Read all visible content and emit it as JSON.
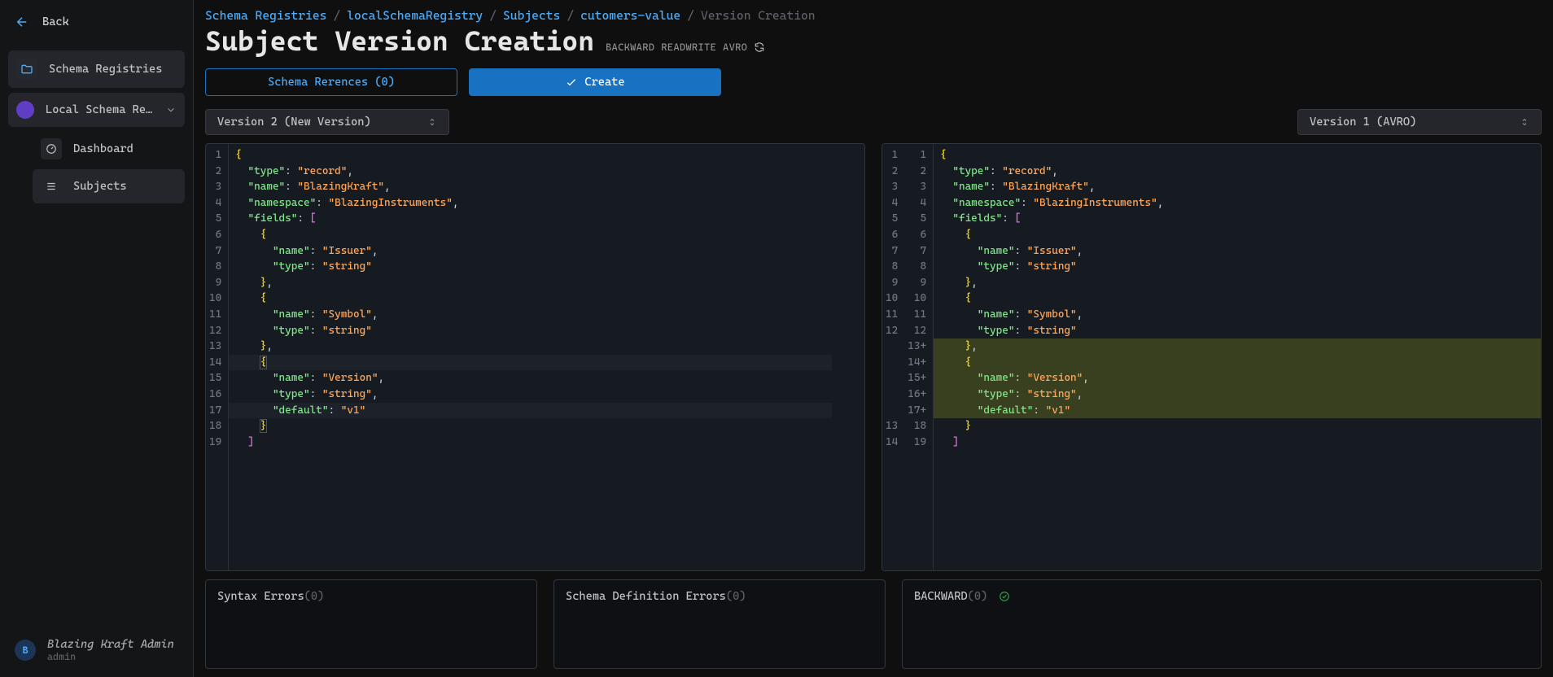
{
  "sidebar": {
    "back": "Back",
    "schemaRegistries": "Schema Registries",
    "localRegistry": "Local Schema Regi…",
    "dashboard": "Dashboard",
    "subjects": "Subjects",
    "userName": "Blazing Kraft Admin",
    "userSub": "admin",
    "userInitial": "B"
  },
  "breadcrumb": {
    "a": "Schema Registries",
    "b": "localSchemaRegistry",
    "c": "Subjects",
    "d": "cutomers-value",
    "e": "Version Creation"
  },
  "header": {
    "title": "Subject Version Creation",
    "tag1": "BACKWARD",
    "tag2": "READWRITE",
    "tag3": "AVRO"
  },
  "actions": {
    "refsBtn": "Schema Rerences (0)",
    "createBtn": "Create"
  },
  "selects": {
    "left": "Version 2 (New Version)",
    "right": "Version 1 (AVRO)"
  },
  "left_editor": {
    "gutter": [
      "1",
      "2",
      "3",
      "4",
      "5",
      "6",
      "7",
      "8",
      "9",
      "10",
      "11",
      "12",
      "13",
      "14",
      "15",
      "16",
      "17",
      "18",
      "19"
    ],
    "lines": [
      {
        "tokens": [
          {
            "t": "{",
            "c": "tok-brc"
          }
        ]
      },
      {
        "tokens": [
          {
            "t": "  ",
            "c": "tok-pun"
          },
          {
            "t": "\"type\"",
            "c": "tok-key"
          },
          {
            "t": ": ",
            "c": "tok-pun"
          },
          {
            "t": "\"record\"",
            "c": "tok-str"
          },
          {
            "t": ",",
            "c": "tok-pun"
          }
        ]
      },
      {
        "tokens": [
          {
            "t": "  ",
            "c": "tok-pun"
          },
          {
            "t": "\"name\"",
            "c": "tok-key"
          },
          {
            "t": ": ",
            "c": "tok-pun"
          },
          {
            "t": "\"BlazingKraft\"",
            "c": "tok-str"
          },
          {
            "t": ",",
            "c": "tok-pun"
          }
        ]
      },
      {
        "tokens": [
          {
            "t": "  ",
            "c": "tok-pun"
          },
          {
            "t": "\"namespace\"",
            "c": "tok-key"
          },
          {
            "t": ": ",
            "c": "tok-pun"
          },
          {
            "t": "\"BlazingInstruments\"",
            "c": "tok-str"
          },
          {
            "t": ",",
            "c": "tok-pun"
          }
        ]
      },
      {
        "tokens": [
          {
            "t": "  ",
            "c": "tok-pun"
          },
          {
            "t": "\"fields\"",
            "c": "tok-key"
          },
          {
            "t": ": ",
            "c": "tok-pun"
          },
          {
            "t": "[",
            "c": "tok-sqb"
          }
        ]
      },
      {
        "tokens": [
          {
            "t": "    ",
            "c": "tok-pun"
          },
          {
            "t": "{",
            "c": "tok-brc"
          }
        ]
      },
      {
        "tokens": [
          {
            "t": "      ",
            "c": "tok-pun"
          },
          {
            "t": "\"name\"",
            "c": "tok-key"
          },
          {
            "t": ": ",
            "c": "tok-pun"
          },
          {
            "t": "\"Issuer\"",
            "c": "tok-str"
          },
          {
            "t": ",",
            "c": "tok-pun"
          }
        ]
      },
      {
        "tokens": [
          {
            "t": "      ",
            "c": "tok-pun"
          },
          {
            "t": "\"type\"",
            "c": "tok-key"
          },
          {
            "t": ": ",
            "c": "tok-pun"
          },
          {
            "t": "\"string\"",
            "c": "tok-str"
          }
        ]
      },
      {
        "tokens": [
          {
            "t": "    ",
            "c": "tok-pun"
          },
          {
            "t": "}",
            "c": "tok-brc"
          },
          {
            "t": ",",
            "c": "tok-pun"
          }
        ]
      },
      {
        "tokens": [
          {
            "t": "    ",
            "c": "tok-pun"
          },
          {
            "t": "{",
            "c": "tok-brc"
          }
        ]
      },
      {
        "tokens": [
          {
            "t": "      ",
            "c": "tok-pun"
          },
          {
            "t": "\"name\"",
            "c": "tok-key"
          },
          {
            "t": ": ",
            "c": "tok-pun"
          },
          {
            "t": "\"Symbol\"",
            "c": "tok-str"
          },
          {
            "t": ",",
            "c": "tok-pun"
          }
        ]
      },
      {
        "tokens": [
          {
            "t": "      ",
            "c": "tok-pun"
          },
          {
            "t": "\"type\"",
            "c": "tok-key"
          },
          {
            "t": ": ",
            "c": "tok-pun"
          },
          {
            "t": "\"string\"",
            "c": "tok-str"
          }
        ]
      },
      {
        "tokens": [
          {
            "t": "    ",
            "c": "tok-pun"
          },
          {
            "t": "}",
            "c": "tok-brc"
          },
          {
            "t": ",",
            "c": "tok-pun"
          }
        ]
      },
      {
        "hl": "cursor",
        "tokens": [
          {
            "t": "    ",
            "c": "tok-pun"
          },
          {
            "t": "{",
            "c": "tok-brc hl-bracket"
          }
        ]
      },
      {
        "tokens": [
          {
            "t": "      ",
            "c": "tok-pun"
          },
          {
            "t": "\"name\"",
            "c": "tok-key"
          },
          {
            "t": ": ",
            "c": "tok-pun"
          },
          {
            "t": "\"Version\"",
            "c": "tok-str"
          },
          {
            "t": ",",
            "c": "tok-pun"
          }
        ]
      },
      {
        "tokens": [
          {
            "t": "      ",
            "c": "tok-pun"
          },
          {
            "t": "\"type\"",
            "c": "tok-key"
          },
          {
            "t": ": ",
            "c": "tok-pun"
          },
          {
            "t": "\"string\"",
            "c": "tok-str"
          },
          {
            "t": ",",
            "c": "tok-pun"
          }
        ]
      },
      {
        "hl": "cursor",
        "tokens": [
          {
            "t": "      ",
            "c": "tok-pun"
          },
          {
            "t": "\"default\"",
            "c": "tok-key"
          },
          {
            "t": ": ",
            "c": "tok-pun"
          },
          {
            "t": "\"v1\"",
            "c": "tok-str"
          }
        ]
      },
      {
        "tokens": [
          {
            "t": "    ",
            "c": "tok-pun"
          },
          {
            "t": "}",
            "c": "tok-brc hl-bracket"
          }
        ]
      },
      {
        "tokens": [
          {
            "t": "  ",
            "c": "tok-pun"
          },
          {
            "t": "]",
            "c": "tok-sqb"
          }
        ]
      }
    ]
  },
  "right_editor": {
    "gutterA": [
      "1",
      "2",
      "3",
      "4",
      "5",
      "6",
      "7",
      "8",
      "9",
      "10",
      "11",
      "12",
      "",
      "",
      "",
      "",
      "",
      "13",
      "14"
    ],
    "gutterB": [
      "1",
      "2",
      "3",
      "4",
      "5",
      "6",
      "7",
      "8",
      "9",
      "10",
      "11",
      "12",
      "13+",
      "14+",
      "15+",
      "16+",
      "17+",
      "18",
      "19"
    ],
    "lines": [
      {
        "tokens": [
          {
            "t": "{",
            "c": "tok-brc"
          }
        ]
      },
      {
        "tokens": [
          {
            "t": "  ",
            "c": "tok-pun"
          },
          {
            "t": "\"type\"",
            "c": "tok-key"
          },
          {
            "t": ": ",
            "c": "tok-pun"
          },
          {
            "t": "\"record\"",
            "c": "tok-str"
          },
          {
            "t": ",",
            "c": "tok-pun"
          }
        ]
      },
      {
        "tokens": [
          {
            "t": "  ",
            "c": "tok-pun"
          },
          {
            "t": "\"name\"",
            "c": "tok-key"
          },
          {
            "t": ": ",
            "c": "tok-pun"
          },
          {
            "t": "\"BlazingKraft\"",
            "c": "tok-str"
          },
          {
            "t": ",",
            "c": "tok-pun"
          }
        ]
      },
      {
        "tokens": [
          {
            "t": "  ",
            "c": "tok-pun"
          },
          {
            "t": "\"namespace\"",
            "c": "tok-key"
          },
          {
            "t": ": ",
            "c": "tok-pun"
          },
          {
            "t": "\"BlazingInstruments\"",
            "c": "tok-str"
          },
          {
            "t": ",",
            "c": "tok-pun"
          }
        ]
      },
      {
        "tokens": [
          {
            "t": "  ",
            "c": "tok-pun"
          },
          {
            "t": "\"fields\"",
            "c": "tok-key"
          },
          {
            "t": ": ",
            "c": "tok-pun"
          },
          {
            "t": "[",
            "c": "tok-sqb"
          }
        ]
      },
      {
        "tokens": [
          {
            "t": "    ",
            "c": "tok-pun"
          },
          {
            "t": "{",
            "c": "tok-brc"
          }
        ]
      },
      {
        "tokens": [
          {
            "t": "      ",
            "c": "tok-pun"
          },
          {
            "t": "\"name\"",
            "c": "tok-key"
          },
          {
            "t": ": ",
            "c": "tok-pun"
          },
          {
            "t": "\"Issuer\"",
            "c": "tok-str"
          },
          {
            "t": ",",
            "c": "tok-pun"
          }
        ]
      },
      {
        "tokens": [
          {
            "t": "      ",
            "c": "tok-pun"
          },
          {
            "t": "\"type\"",
            "c": "tok-key"
          },
          {
            "t": ": ",
            "c": "tok-pun"
          },
          {
            "t": "\"string\"",
            "c": "tok-str"
          }
        ]
      },
      {
        "tokens": [
          {
            "t": "    ",
            "c": "tok-pun"
          },
          {
            "t": "}",
            "c": "tok-brc"
          },
          {
            "t": ",",
            "c": "tok-pun"
          }
        ]
      },
      {
        "tokens": [
          {
            "t": "    ",
            "c": "tok-pun"
          },
          {
            "t": "{",
            "c": "tok-brc"
          }
        ]
      },
      {
        "tokens": [
          {
            "t": "      ",
            "c": "tok-pun"
          },
          {
            "t": "\"name\"",
            "c": "tok-key"
          },
          {
            "t": ": ",
            "c": "tok-pun"
          },
          {
            "t": "\"Symbol\"",
            "c": "tok-str"
          },
          {
            "t": ",",
            "c": "tok-pun"
          }
        ]
      },
      {
        "tokens": [
          {
            "t": "      ",
            "c": "tok-pun"
          },
          {
            "t": "\"type\"",
            "c": "tok-key"
          },
          {
            "t": ": ",
            "c": "tok-pun"
          },
          {
            "t": "\"string\"",
            "c": "tok-str"
          }
        ]
      },
      {
        "diff": "add",
        "tokens": [
          {
            "t": "    ",
            "c": "tok-pun"
          },
          {
            "t": "}",
            "c": "tok-brc"
          },
          {
            "t": ",",
            "c": "tok-pun"
          }
        ]
      },
      {
        "diff": "add",
        "tokens": [
          {
            "t": "    ",
            "c": "tok-pun"
          },
          {
            "t": "{",
            "c": "tok-brc"
          }
        ]
      },
      {
        "diff": "add",
        "tokens": [
          {
            "t": "      ",
            "c": "tok-pun"
          },
          {
            "t": "\"name\"",
            "c": "tok-key"
          },
          {
            "t": ": ",
            "c": "tok-pun"
          },
          {
            "t": "\"Version\"",
            "c": "tok-str"
          },
          {
            "t": ",",
            "c": "tok-pun"
          }
        ]
      },
      {
        "diff": "add",
        "tokens": [
          {
            "t": "      ",
            "c": "tok-pun"
          },
          {
            "t": "\"type\"",
            "c": "tok-key"
          },
          {
            "t": ": ",
            "c": "tok-pun"
          },
          {
            "t": "\"string\"",
            "c": "tok-str"
          },
          {
            "t": ",",
            "c": "tok-pun"
          }
        ]
      },
      {
        "diff": "add",
        "tokens": [
          {
            "t": "      ",
            "c": "tok-pun"
          },
          {
            "t": "\"default\"",
            "c": "tok-key"
          },
          {
            "t": ": ",
            "c": "tok-pun"
          },
          {
            "t": "\"v1\"",
            "c": "tok-str"
          }
        ]
      },
      {
        "tokens": [
          {
            "t": "    ",
            "c": "tok-pun"
          },
          {
            "t": "}",
            "c": "tok-brc"
          }
        ]
      },
      {
        "tokens": [
          {
            "t": "  ",
            "c": "tok-pun"
          },
          {
            "t": "]",
            "c": "tok-sqb"
          }
        ]
      }
    ]
  },
  "errors": {
    "syntaxLabel": "Syntax Errors",
    "syntaxCount": "(0)",
    "schemaDefLabel": "Schema Definition Errors",
    "schemaDefCount": "(0)",
    "backwardLabel": "BACKWARD",
    "backwardCount": "(0)"
  },
  "glyphs": {
    "chevronLeft": "←",
    "chevronDown": "⌄",
    "upDown": "⇅",
    "check": "✓"
  }
}
